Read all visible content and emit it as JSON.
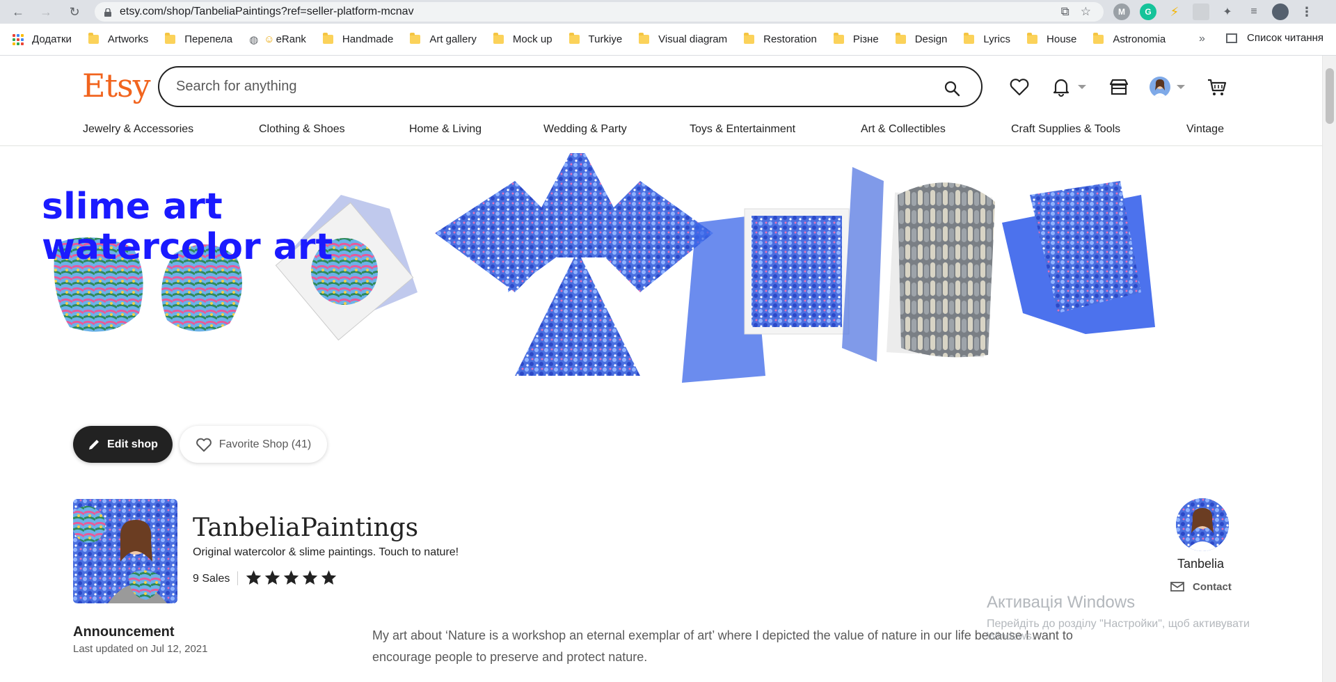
{
  "browser": {
    "url": "etsy.com/shop/TanbeliaPaintings?ref=seller-platform-mcnav",
    "bookmarks": [
      "Додатки",
      "Artworks",
      "Перепела",
      "eRank",
      "Handmade",
      "Art gallery",
      "Mock up",
      "Turkiye",
      "Visual diagram",
      "Restoration",
      "Різне",
      "Design",
      "Lyrics",
      "House",
      "Astronomia"
    ],
    "more": "»",
    "reading_list": "Список читання",
    "extensions": [
      "M",
      "G",
      "⚡"
    ]
  },
  "header": {
    "logo": "Etsy",
    "search_placeholder": "Search for anything"
  },
  "categories": [
    "Jewelry & Accessories",
    "Clothing & Shoes",
    "Home & Living",
    "Wedding & Party",
    "Toys & Entertainment",
    "Art & Collectibles",
    "Craft Supplies & Tools",
    "Vintage"
  ],
  "banner": {
    "line1": "slime art",
    "line2": "watercolor art"
  },
  "actions": {
    "edit": "Edit shop",
    "favorite": "Favorite Shop (41)"
  },
  "shop": {
    "name": "TanbeliaPaintings",
    "tagline": "Original watercolor & slime paintings. Touch to nature!",
    "sales": "9 Sales",
    "rating": 5
  },
  "owner": {
    "name": "Tanbelia",
    "contact": "Contact"
  },
  "announcement": {
    "title": "Announcement",
    "updated": "Last updated on Jul 12, 2021",
    "text": "My art about ‘Nature is a workshop an eternal exemplar of art’ where I depicted the value of nature in our life because I want to encourage people to preserve and protect nature."
  },
  "windows_activation": {
    "title": "Активація Windows",
    "subtitle": "Перейдіть до розділу \"Настройки\", щоб активувати Windows."
  },
  "colors": {
    "etsy_orange": "#f1641e",
    "banner_blue": "#1a1aff"
  }
}
